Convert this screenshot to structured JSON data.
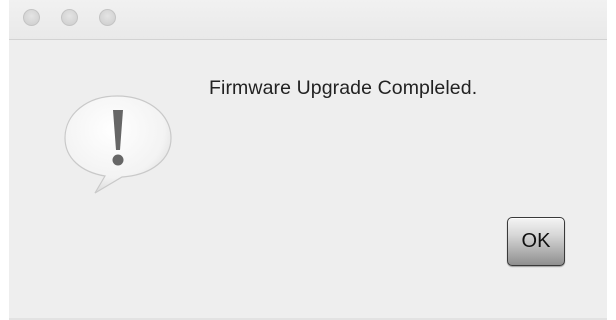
{
  "window": {
    "controls": [
      "close",
      "minimize",
      "zoom"
    ]
  },
  "alert": {
    "icon": "exclamation-speech-bubble-icon",
    "message": "Firmware Upgrade Compleled.",
    "ok_label": "OK"
  }
}
